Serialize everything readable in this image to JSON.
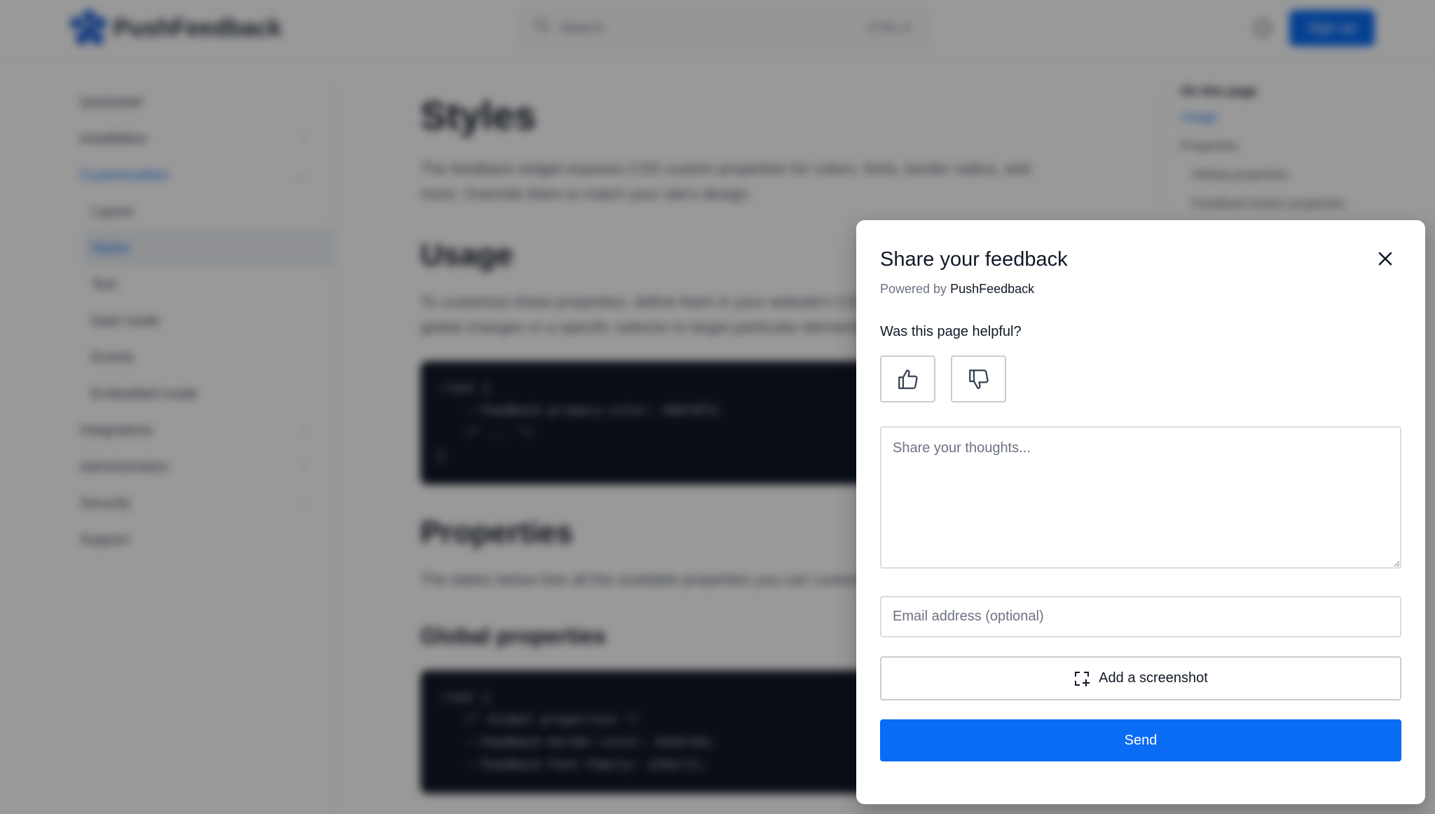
{
  "background_page": {
    "brand": "PushFeedback",
    "search": {
      "label": "Search",
      "shortcut": "CTRL K"
    },
    "signup_label": "Sign up",
    "sidebar": {
      "items": [
        {
          "label": "Quickstart"
        },
        {
          "label": "Installation"
        },
        {
          "label": "Customization"
        },
        {
          "label": "Layout"
        },
        {
          "label": "Styles"
        },
        {
          "label": "Text"
        },
        {
          "label": "Dark mode"
        },
        {
          "label": "Events"
        },
        {
          "label": "Embedded mode"
        },
        {
          "label": "Integrations"
        },
        {
          "label": "Administration"
        },
        {
          "label": "Security"
        },
        {
          "label": "Support"
        }
      ]
    },
    "content": {
      "title": "Styles",
      "intro": "The feedback widget exposes CSS custom properties for colors, fonts, border radius, and more. Override them to match your site's design.",
      "usage_heading": "Usage",
      "usage_text": "To customize these properties, define them in your website's CSS. Use the :root selector for global changes or a specific selector to target particular elements.",
      "code1": [
        ":root {",
        "  --feedback-primary-color: #0070f3;",
        "  /* ... */",
        "}"
      ],
      "properties_heading": "Properties",
      "properties_text": "The tables below lists all the available properties you can customize.",
      "global_heading": "Global properties",
      "code2": [
        ":root {",
        "  /* Global properties */",
        "  --feedback-border-color: #e5e7eb;",
        "  --feedback-font-family: inherit;"
      ]
    },
    "toc": {
      "title": "On this page",
      "items": [
        {
          "label": "Usage"
        },
        {
          "label": "Properties"
        },
        {
          "label": "Global properties"
        },
        {
          "label": "Feedback button properties"
        }
      ]
    }
  },
  "modal": {
    "title": "Share your feedback",
    "powered_by_prefix": "Powered by",
    "powered_by_brand": "PushFeedback",
    "question": "Was this page helpful?",
    "message_placeholder": "Share your thoughts...",
    "email_placeholder": "Email address (optional)",
    "screenshot_label": "Add a screenshot",
    "send_label": "Send",
    "icons": {
      "close": "close-icon",
      "upvote": "thumbs-up-icon",
      "downvote": "thumbs-down-icon",
      "screenshot": "screenshot-icon"
    },
    "colors": {
      "primary": "#0a6cf5",
      "overlay": "rgba(0,0,0,0.40)"
    }
  }
}
